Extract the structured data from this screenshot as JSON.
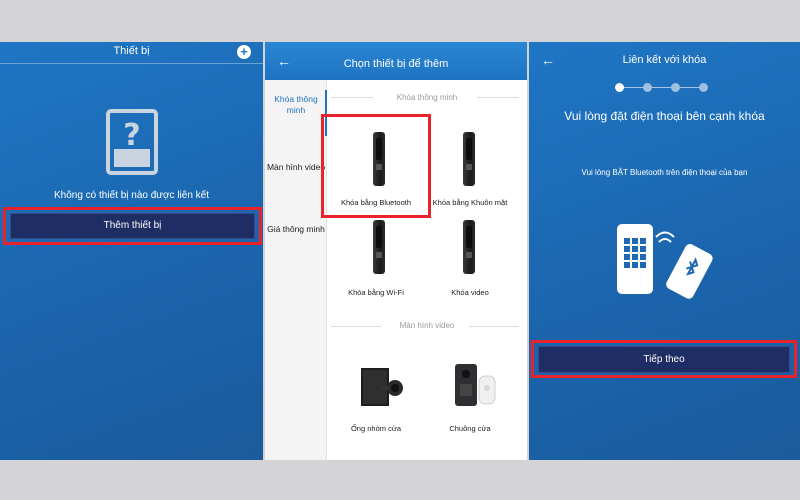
{
  "panel1": {
    "title": "Thiết bị",
    "plus_icon": "plus-icon",
    "empty_icon": "device-question-icon",
    "empty_text": "Không có thiết bị nào được liên kết",
    "add_button": "Thêm thiết bị"
  },
  "panel2": {
    "title": "Chọn thiết bị để thêm",
    "categories": [
      {
        "label": "Khóa thông minh",
        "active": true
      },
      {
        "label": "Màn hình video",
        "active": false
      },
      {
        "label": "Giá thông minh",
        "active": false
      }
    ],
    "sections": [
      {
        "title": "Khóa thông minh",
        "items": [
          "Khóa bằng Bluetooth",
          "Khóa bằng Khuôn mặt",
          "Khóa bằng Wi-Fi",
          "Khóa video"
        ]
      },
      {
        "title": "Màn hình video",
        "items": [
          "Ống nhòm cửa",
          "Chuông cửa"
        ]
      }
    ]
  },
  "panel3": {
    "title": "Liên kết với khóa",
    "message": "Vui lòng đặt điện thoại bên cạnh khóa",
    "subtext": "Vui lòng BẬT Bluetooth trên điện thoại của bạn",
    "steps_total": 4,
    "step_current": 1,
    "next_button": "Tiếp theo",
    "illustration_icon": "lock-bluetooth-phone-icon"
  },
  "colors": {
    "primary_blue": "#1f76c4",
    "dark_button": "#1e2d63",
    "highlight_red": "#e8232b",
    "active_category": "#1f74c2"
  }
}
